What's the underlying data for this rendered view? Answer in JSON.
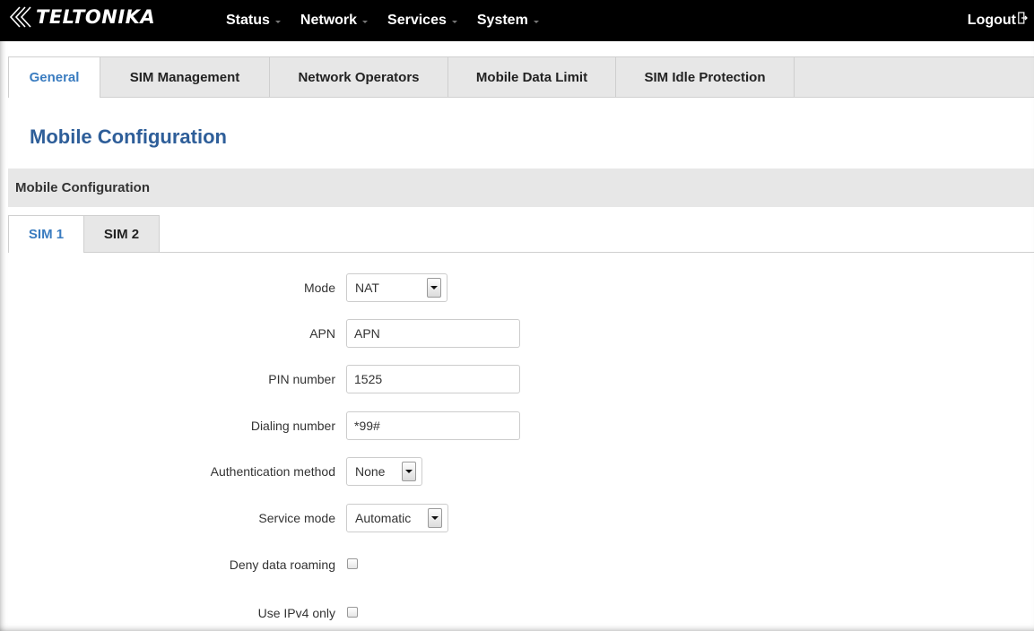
{
  "header": {
    "brand": "TELTONIKA",
    "nav": [
      {
        "label": "Status"
      },
      {
        "label": "Network"
      },
      {
        "label": "Services"
      },
      {
        "label": "System"
      }
    ],
    "logout_label": "Logout",
    "logo_icon": "teltonika-chevrons-icon",
    "logout_icon": "logout-door-icon"
  },
  "tabs": [
    {
      "label": "General",
      "active": true
    },
    {
      "label": "SIM Management"
    },
    {
      "label": "Network Operators"
    },
    {
      "label": "Mobile Data Limit"
    },
    {
      "label": "SIM Idle Protection"
    }
  ],
  "page_title": "Mobile Configuration",
  "section": {
    "title": "Mobile Configuration",
    "sim_tabs": [
      {
        "label": "SIM 1",
        "active": true
      },
      {
        "label": "SIM 2"
      }
    ]
  },
  "form": {
    "mode": {
      "label": "Mode",
      "value": "NAT"
    },
    "apn": {
      "label": "APN",
      "value": "APN"
    },
    "pin": {
      "label": "PIN number",
      "value": "1525"
    },
    "dialing": {
      "label": "Dialing number",
      "value": "*99#"
    },
    "auth": {
      "label": "Authentication method",
      "value": "None"
    },
    "service": {
      "label": "Service mode",
      "value": "Automatic"
    },
    "deny_roaming": {
      "label": "Deny data roaming",
      "checked": false
    },
    "ipv4_only": {
      "label": "Use IPv4 only",
      "checked": false
    }
  },
  "colors": {
    "accent": "#3a7cc0",
    "title": "#2e5e99",
    "navbar": "#000000",
    "panel": "#e7e7e7"
  }
}
